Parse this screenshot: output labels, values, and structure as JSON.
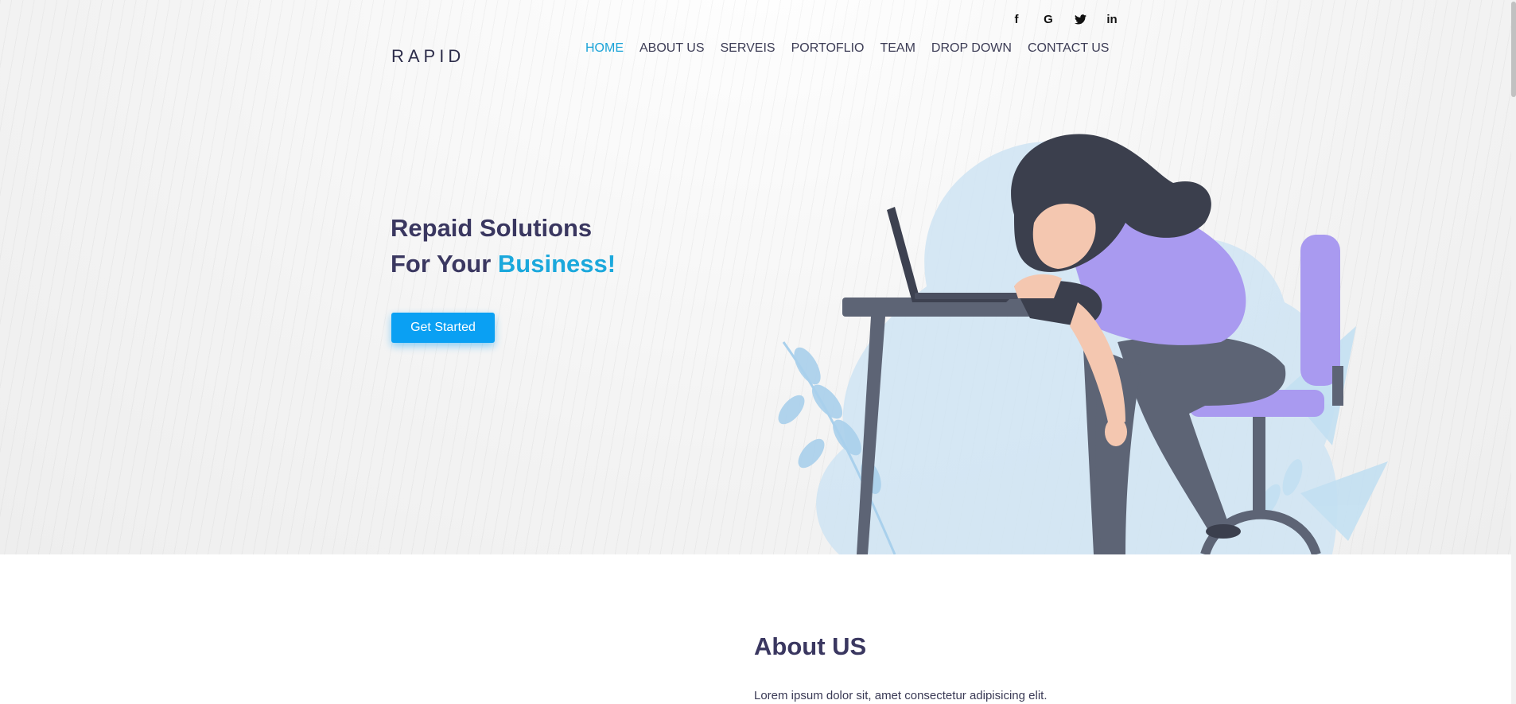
{
  "brand": {
    "logo": "RAPID"
  },
  "social": [
    {
      "icon": "facebook-icon",
      "glyph": "f"
    },
    {
      "icon": "google-icon",
      "glyph": "G"
    },
    {
      "icon": "twitter-icon",
      "glyph": "❧"
    },
    {
      "icon": "linkedin-icon",
      "glyph": "in"
    }
  ],
  "nav": {
    "items": [
      "HOME",
      "ABOUT US",
      "SERVEIS",
      "PORTOFLIO",
      "TEAM",
      "DROP DOWN",
      "CONTACT US"
    ],
    "active_index": 0
  },
  "hero": {
    "line1": "Repaid Solutions",
    "line2_prefix": "For Your ",
    "line2_accent": "Business!",
    "cta": "Get Started"
  },
  "about": {
    "title": "About US",
    "text": "Lorem ipsum dolor sit, amet consectetur adipisicing elit."
  },
  "colors": {
    "accent": "#1ba8dc",
    "heading": "#3a3760",
    "button": "#0aa0f3",
    "chair": "#a99af0"
  }
}
